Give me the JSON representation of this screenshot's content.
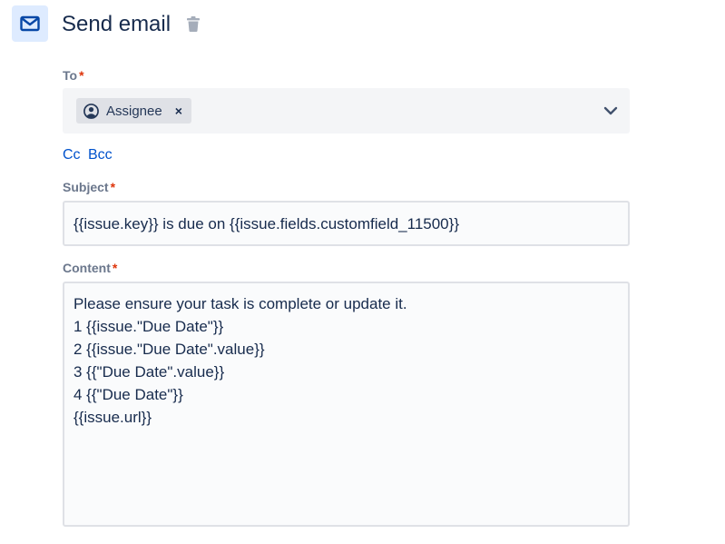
{
  "header": {
    "title": "Send email",
    "icon": "mail-icon",
    "delete_icon": "trash-icon",
    "icon_color": "#0747a6",
    "icon_bg": "#deebff"
  },
  "to": {
    "label": "To",
    "required_mark": "*",
    "recipient_chip": {
      "label": "Assignee",
      "icon": "user-circle-icon",
      "remove_icon": "×"
    },
    "dropdown_icon": "chevron-down-icon"
  },
  "links": {
    "cc": "Cc",
    "bcc": "Bcc"
  },
  "subject": {
    "label": "Subject",
    "required_mark": "*",
    "value": "{{issue.key}} is due on {{issue.fields.customfield_11500}}"
  },
  "content": {
    "label": "Content",
    "required_mark": "*",
    "lines": [
      "Please ensure your task is complete or update it.",
      "1 {{issue.\"Due Date\"}}",
      "2 {{issue.\"Due Date\".value}}",
      "3 {{\"Due Date\".value}}",
      "4 {{\"Due Date\"}}",
      "{{issue.url}}"
    ]
  },
  "colors": {
    "link": "#0052cc",
    "required": "#de350b",
    "label": "#6b778c",
    "text": "#172b4d"
  }
}
